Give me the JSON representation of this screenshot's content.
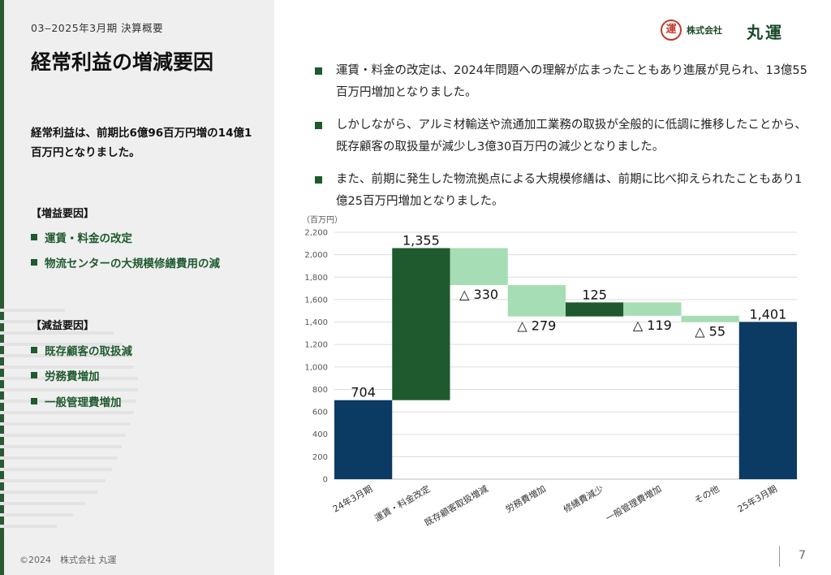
{
  "header": {
    "section": "03‒2025年3月期 決算概要",
    "title": "経常利益の増減要因"
  },
  "summary": "経常利益は、前期比6億96百万円増の14億1百万円となりました。",
  "increase": {
    "title": "【増益要因】",
    "items": [
      "運賃・料金の改定",
      "物流センターの大規模修繕費用の減"
    ]
  },
  "decrease": {
    "title": "【減益要因】",
    "items": [
      "既存顧客の取扱減",
      "労務費増加",
      "一般管理費増加"
    ]
  },
  "logo": {
    "mark": "運",
    "company": "株式会社",
    "name": "丸運"
  },
  "bullets": [
    "運賃・料金の改定は、2024年問題への理解が広まったこともあり進展が見られ、13億55百万円増加となりました。",
    "しかしながら、アルミ材輸送や流通加工業務の取扱が全般的に低調に推移したことから、既存顧客の取扱量が減少し3億30百万円の減少となりました。",
    "また、前期に発生した物流拠点による大規模修繕は、前期に比べ抑えられたこともあり1億25百万円増加となりました。"
  ],
  "footer": {
    "copyright": "©2024　株式会社 丸運",
    "page": "7"
  },
  "colors": {
    "total": "#0b3a63",
    "increase": "#1f5a2e",
    "decrease": "#a6ddb4"
  },
  "chart_data": {
    "type": "waterfall",
    "unit_label": "（百万円）",
    "ylim": [
      0,
      2200
    ],
    "yticks": [
      "0",
      "200",
      "400",
      "600",
      "800",
      "1,000",
      "1,200",
      "1,400",
      "1,600",
      "1,800",
      "2,000",
      "2,200"
    ],
    "grid": true,
    "categories": [
      "24年3月期",
      "運賃・料金改定",
      "既存顧客取扱増減",
      "労務費増加",
      "修繕費減少",
      "一般管理費増加",
      "その他",
      "25年3月期"
    ],
    "kinds": [
      "total",
      "increase",
      "decrease",
      "decrease",
      "increase",
      "decrease",
      "decrease",
      "total"
    ],
    "values": [
      704,
      1355,
      -330,
      -279,
      125,
      -119,
      -55,
      1401
    ],
    "labels": [
      "704",
      "1,355",
      "△ 330",
      "△ 279",
      "125",
      "△ 119",
      "△ 55",
      "1,401"
    ]
  }
}
